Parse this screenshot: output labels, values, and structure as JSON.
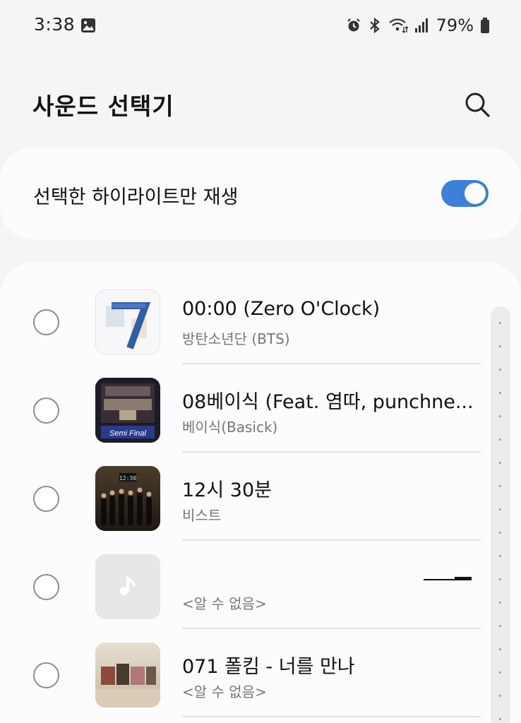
{
  "status_bar": {
    "time": "3:38",
    "battery": "79%",
    "icons": [
      "gallery-icon",
      "alarm-icon",
      "bluetooth-icon",
      "wifi-icon",
      "signal-icon",
      "battery-icon"
    ]
  },
  "header": {
    "title": "사운드 선택기",
    "search_icon": "search-icon"
  },
  "highlight": {
    "label": "선택한 하이라이트만 재생",
    "toggle_on": true,
    "accent_color": "#3e7fd9"
  },
  "songs": [
    {
      "title": "00:00 (Zero O'Clock)",
      "artist": "방탄소년단 (BTS)",
      "art": "bts-album-art",
      "art_text": "7"
    },
    {
      "title": "08베이식 (Feat. 염따, punchne...",
      "artist": "베이식(Basick)",
      "art": "smtm-album-art",
      "art_text": "Semi Final"
    },
    {
      "title": "12시 30분",
      "artist": "비스트",
      "art": "beast-album-art",
      "art_text": "12:30"
    },
    {
      "title": "",
      "artist": "<알 수 없음>",
      "art": "music-note-icon"
    },
    {
      "title": "071 폴킴 - 너를 만나",
      "artist": "<알 수 없음>",
      "art": "paulkim-album-art"
    }
  ]
}
